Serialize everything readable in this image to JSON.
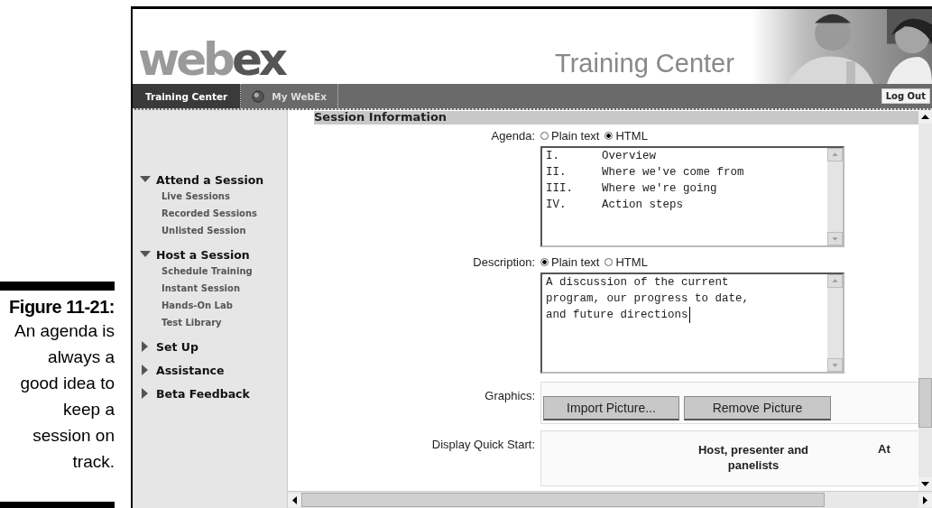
{
  "caption": {
    "figure": "Figure 11-21:",
    "text": "An agenda is always a good idea to keep a session on track."
  },
  "header": {
    "logo": {
      "parts": [
        "web",
        "ex"
      ]
    },
    "title": "Training Center"
  },
  "nav": {
    "tabs": [
      {
        "label": "Training Center",
        "selected": true,
        "icon": false
      },
      {
        "label": "My WebEx",
        "selected": false,
        "icon": true
      }
    ],
    "logout": "Log Out"
  },
  "sidebar": {
    "sections": [
      {
        "label": "Attend a Session",
        "expanded": true,
        "children": [
          {
            "label": "Live Sessions"
          },
          {
            "label": "Recorded Sessions"
          },
          {
            "label": "Unlisted Session"
          }
        ]
      },
      {
        "label": "Host a Session",
        "expanded": true,
        "children": [
          {
            "label": "Schedule Training"
          },
          {
            "label": "Instant Session"
          },
          {
            "label": "Hands-On Lab"
          },
          {
            "label": "Test Library"
          }
        ]
      },
      {
        "label": "Set Up",
        "expanded": false
      },
      {
        "label": "Assistance",
        "expanded": false
      },
      {
        "label": "Beta Feedback",
        "expanded": false
      }
    ]
  },
  "form": {
    "section": "Session Information",
    "agenda": {
      "label": "Agenda:",
      "formats": [
        {
          "label": "Plain text",
          "selected": false
        },
        {
          "label": "HTML",
          "selected": true
        }
      ],
      "lines": [
        {
          "number": "I.",
          "text": "Overview"
        },
        {
          "number": "II.",
          "text": "Where we've come from"
        },
        {
          "number": "III.",
          "text": "Where we're going"
        },
        {
          "number": "IV.",
          "text": "Action steps"
        }
      ]
    },
    "description": {
      "label": "Description:",
      "formats": [
        {
          "label": "Plain text",
          "selected": true
        },
        {
          "label": "HTML",
          "selected": false
        }
      ],
      "lines": [
        "A discussion of the current",
        "program, our progress to date,",
        "and future directions"
      ]
    },
    "graphics": {
      "label": "Graphics:",
      "buttons": [
        "Import Picture...",
        "Remove Picture"
      ]
    },
    "quick_start": {
      "label": "Display Quick Start:",
      "columns": [
        "Host, presenter and panelists",
        "At"
      ]
    }
  }
}
